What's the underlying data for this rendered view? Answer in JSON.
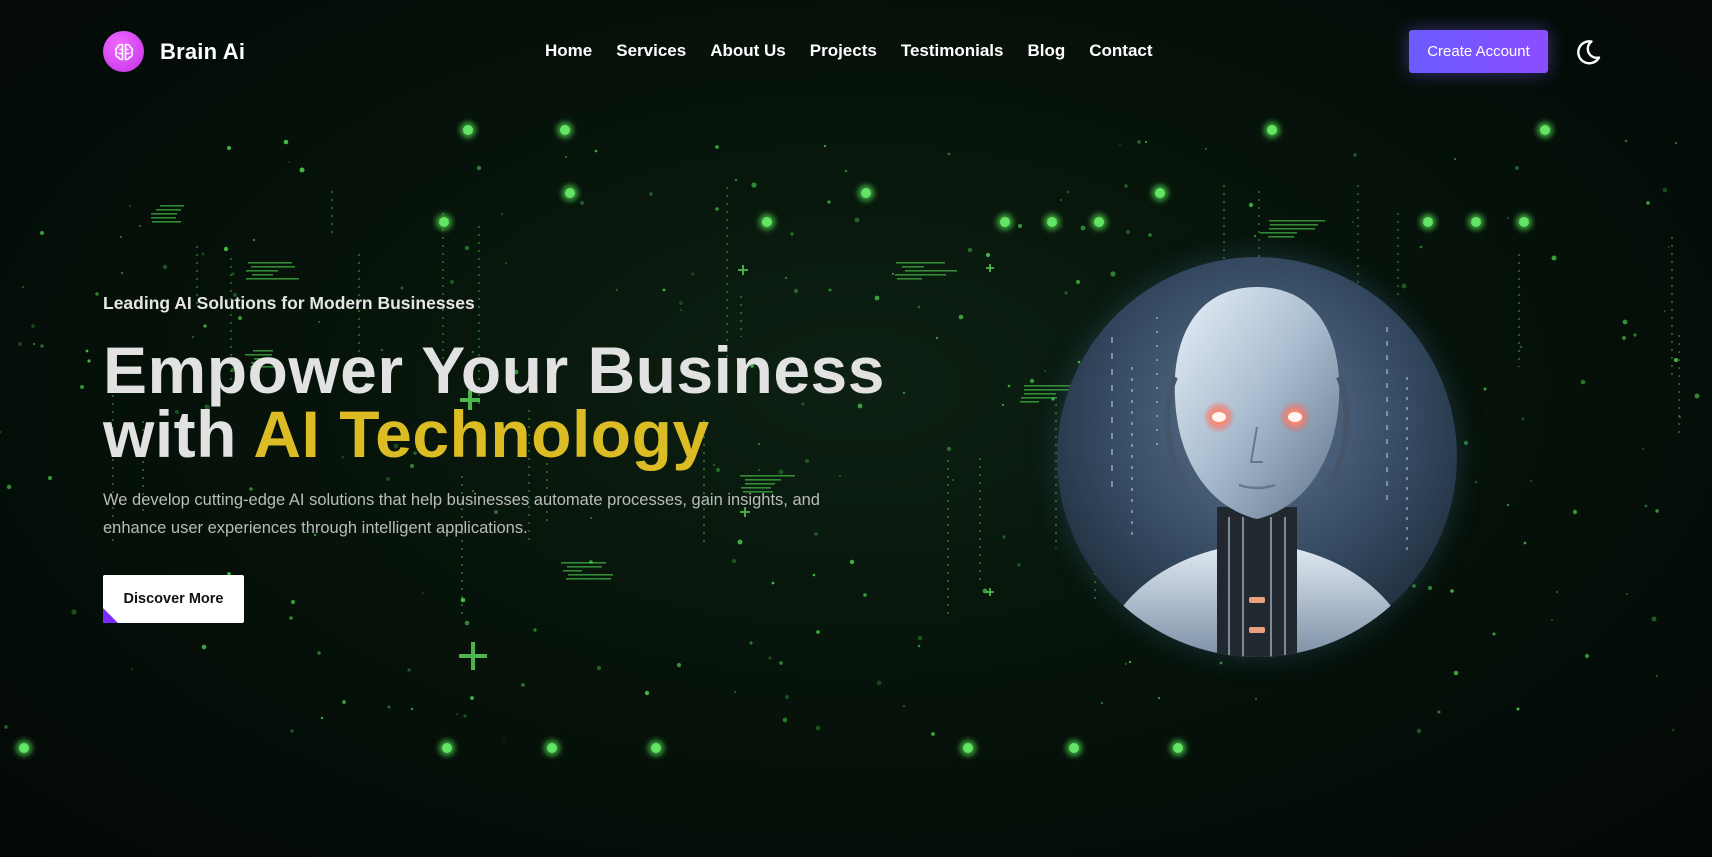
{
  "brand": {
    "name": "Brain Ai",
    "logo_icon": "brain-icon",
    "logo_color": "#d63af0"
  },
  "nav": {
    "items": [
      {
        "label": "Home"
      },
      {
        "label": "Services"
      },
      {
        "label": "About Us"
      },
      {
        "label": "Projects"
      },
      {
        "label": "Testimonials"
      },
      {
        "label": "Blog"
      },
      {
        "label": "Contact"
      }
    ]
  },
  "header": {
    "cta_label": "Create Account",
    "cta_color": "#7556ff",
    "theme_toggle_icon": "moon-icon"
  },
  "hero": {
    "eyebrow": "Leading AI Solutions for Modern Businesses",
    "headline_line1": "Empower Your Business",
    "headline_line2_prefix": "with ",
    "headline_line2_accent": "AI Technology",
    "accent_color": "#dcbc24",
    "description": "We develop cutting-edge AI solutions that help businesses automate processes, gain insights, and enhance user experiences through intelligent applications.",
    "button_label": "Discover More",
    "image": "robot-head-illustration"
  },
  "theme": {
    "background": "#050d08",
    "particle_color": "#4fd84f"
  }
}
